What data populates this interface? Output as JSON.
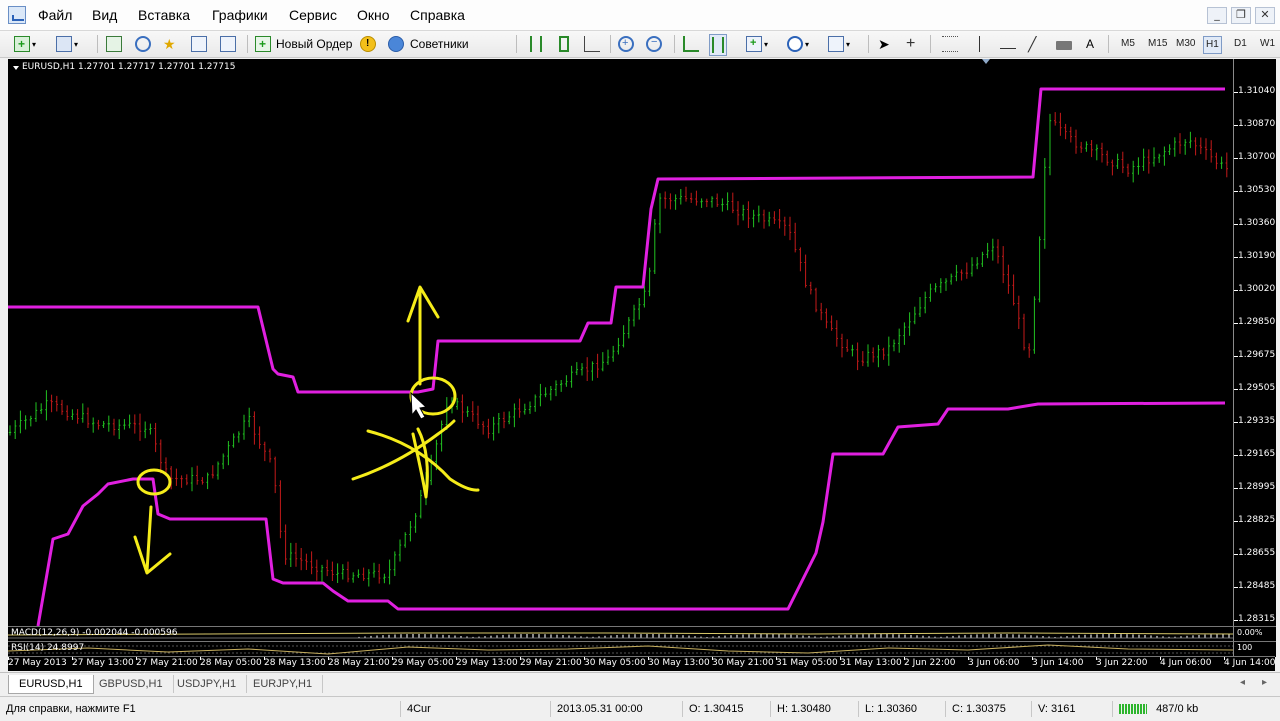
{
  "menu": [
    "Файл",
    "Вид",
    "Вставка",
    "Графики",
    "Сервис",
    "Окно",
    "Справка"
  ],
  "toolbar": {
    "new_order": "Новый Ордер",
    "advisors": "Советники",
    "timeframes": [
      "M5",
      "M15",
      "M30",
      "H1",
      "D1",
      "W1"
    ],
    "active_timeframe": "H1",
    "tool_text": "A"
  },
  "chart": {
    "title": "EURUSD,H1  1.27701 1.27717 1.27701 1.27715",
    "price_labels": [
      "1.31040",
      "1.30870",
      "1.30700",
      "1.30530",
      "1.30360",
      "1.30190",
      "1.30020",
      "1.29850",
      "1.29675",
      "1.29505",
      "1.29335",
      "1.29165",
      "1.28995",
      "1.28825",
      "1.28655",
      "1.28485",
      "1.28315"
    ],
    "time_labels": [
      "27 May 2013",
      "27 May 13:00",
      "27 May 21:00",
      "28 May 05:00",
      "28 May 13:00",
      "28 May 21:00",
      "29 May 05:00",
      "29 May 13:00",
      "29 May 21:00",
      "30 May 05:00",
      "30 May 13:00",
      "30 May 21:00",
      "31 May 05:00",
      "31 May 13:00",
      "2 Jun 22:00",
      "3 Jun 06:00",
      "3 Jun 14:00",
      "3 Jun 22:00",
      "4 Jun 06:00",
      "4 Jun 14:00"
    ],
    "macd_label": "MACD(12,26,9) -0.002044 -0.000596",
    "macd_axis": "0.00%",
    "rsi_label": "RSI(14) 24.8997",
    "rsi_axis": "100"
  },
  "colors": {
    "channel": "#e020e0",
    "bull": "#21c221",
    "bear": "#c41a1a",
    "annotation": "#f5ec1a"
  },
  "tabs": [
    "EURUSD,H1",
    "GBPUSD,H1",
    "USDJPY,H1",
    "EURJPY,H1"
  ],
  "active_tab": "EURUSD,H1",
  "status": {
    "help": "Для справки, нажмите F1",
    "profile": "4Cur",
    "datetime": "2013.05.31 00:00",
    "open": "O: 1.30415",
    "high": "H: 1.30480",
    "low": "L: 1.30360",
    "close": "C: 1.30375",
    "volume": "V: 3161",
    "traffic": "487/0 kb"
  }
}
